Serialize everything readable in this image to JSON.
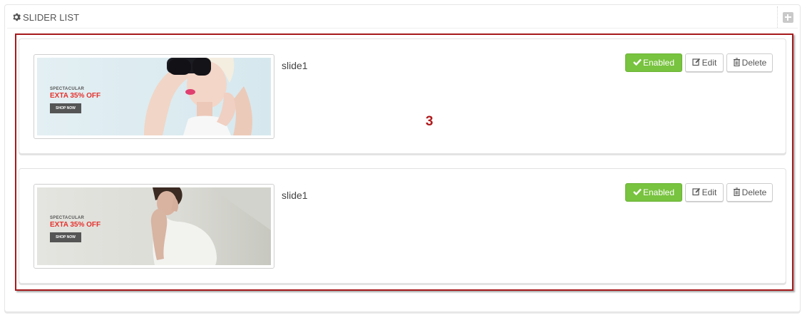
{
  "panel": {
    "title": "SLIDER LIST",
    "title_icon": "gear-icon",
    "add_icon": "plus-square-icon"
  },
  "annotation": {
    "label": "3",
    "color": "#a8191c"
  },
  "slides": [
    {
      "name": "slide1",
      "banner": {
        "subtitle": "SPECTACULAR",
        "headline": "EXTA 35% OFF",
        "button": "SHOP NOW"
      },
      "status_label": "Enabled",
      "edit_label": "Edit",
      "delete_label": "Delete"
    },
    {
      "name": "slide1",
      "banner": {
        "subtitle": "SPECTACULAR",
        "headline": "EXTA 35% OFF",
        "button": "SHOP NOW"
      },
      "status_label": "Enabled",
      "edit_label": "Edit",
      "delete_label": "Delete"
    }
  ],
  "colors": {
    "enabled": "#78c33f",
    "accent_red": "#e5322d"
  }
}
